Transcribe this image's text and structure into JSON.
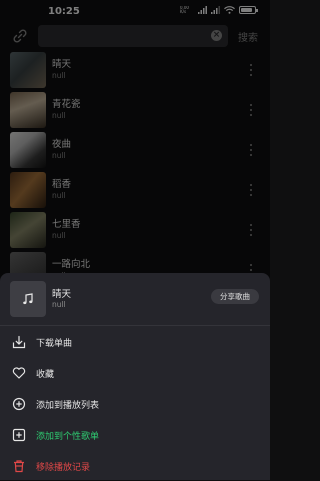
{
  "status_bar": {
    "time": "10:25",
    "network_speed": "0.00 K/s",
    "battery_level": 0.85
  },
  "search": {
    "value": "",
    "clear_symbol": "×",
    "button_label": "搜索"
  },
  "songs": [
    {
      "title": "晴天",
      "artist": "null"
    },
    {
      "title": "青花瓷",
      "artist": "null"
    },
    {
      "title": "夜曲",
      "artist": "null"
    },
    {
      "title": "稻香",
      "artist": "null"
    },
    {
      "title": "七里香",
      "artist": "null"
    },
    {
      "title": "一路向北",
      "artist": "null"
    }
  ],
  "sheet": {
    "song_title": "晴天",
    "song_artist": "null",
    "share_label": "分享歌曲",
    "actions": [
      {
        "label": "下载单曲",
        "icon": "download-icon",
        "color": "#e6e6e6"
      },
      {
        "label": "收藏",
        "icon": "heart-icon",
        "color": "#e6e6e6"
      },
      {
        "label": "添加到播放列表",
        "icon": "add-circle-icon",
        "color": "#e6e6e6"
      },
      {
        "label": "添加到个性歌单",
        "icon": "add-square-icon",
        "color": "#2ecc71"
      },
      {
        "label": "移除播放记录",
        "icon": "trash-icon",
        "color": "#e04848"
      }
    ]
  },
  "colors": {
    "background": "#0f0f10",
    "sheet": "#25252b",
    "accent_green": "#2ecc71",
    "danger_red": "#e04848"
  }
}
